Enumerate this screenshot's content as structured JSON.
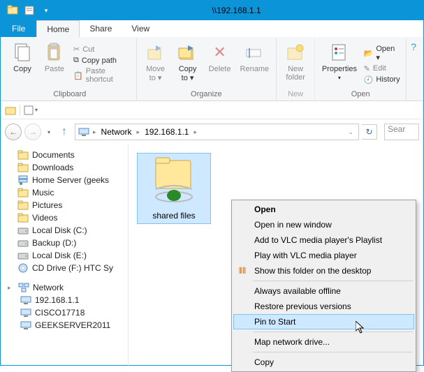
{
  "window": {
    "title": "\\\\192.168.1.1"
  },
  "tabs": {
    "file": "File",
    "home": "Home",
    "share": "Share",
    "view": "View"
  },
  "ribbon": {
    "clipboard": {
      "label": "Clipboard",
      "copy": "Copy",
      "paste": "Paste",
      "cut": "Cut",
      "copy_path": "Copy path",
      "paste_shortcut": "Paste shortcut"
    },
    "organize": {
      "label": "Organize",
      "move_to": "Move\nto ▾",
      "copy_to": "Copy\nto ▾",
      "delete": "Delete",
      "rename": "Rename"
    },
    "new": {
      "label": "New",
      "new_folder": "New\nfolder"
    },
    "open": {
      "label": "Open",
      "properties": "Properties",
      "open": "Open ▾",
      "edit": "Edit",
      "history": "History"
    }
  },
  "breadcrumb": {
    "root": "Network",
    "node": "192.168.1.1"
  },
  "search_placeholder": "Sear",
  "tree": {
    "items": [
      {
        "label": "Documents",
        "icon": "folder"
      },
      {
        "label": "Downloads",
        "icon": "folder"
      },
      {
        "label": "Home Server (geeks",
        "icon": "server"
      },
      {
        "label": "Music",
        "icon": "folder"
      },
      {
        "label": "Pictures",
        "icon": "folder"
      },
      {
        "label": "Videos",
        "icon": "folder"
      },
      {
        "label": "Local Disk (C:)",
        "icon": "drive"
      },
      {
        "label": "Backup (D:)",
        "icon": "drive"
      },
      {
        "label": "Local Disk (E:)",
        "icon": "drive"
      },
      {
        "label": "CD Drive (F:) HTC Sy",
        "icon": "cd"
      }
    ],
    "network": {
      "label": "Network",
      "children": [
        {
          "label": "192.168.1.1"
        },
        {
          "label": "CISCO17718"
        },
        {
          "label": "GEEKSERVER2011"
        }
      ]
    }
  },
  "file_item": {
    "name": "shared files"
  },
  "context_menu": {
    "items": [
      {
        "label": "Open",
        "bold": true
      },
      {
        "label": "Open in new window"
      },
      {
        "label": "Add to VLC media player's Playlist"
      },
      {
        "label": "Play with VLC media player"
      },
      {
        "label": "Show this folder on the desktop",
        "icon": "fences"
      },
      {
        "sep": true
      },
      {
        "label": "Always available offline"
      },
      {
        "label": "Restore previous versions"
      },
      {
        "label": "Pin to Start",
        "hover": true
      },
      {
        "sep": true
      },
      {
        "label": "Map network drive..."
      },
      {
        "sep": true
      },
      {
        "label": "Copy"
      }
    ]
  }
}
